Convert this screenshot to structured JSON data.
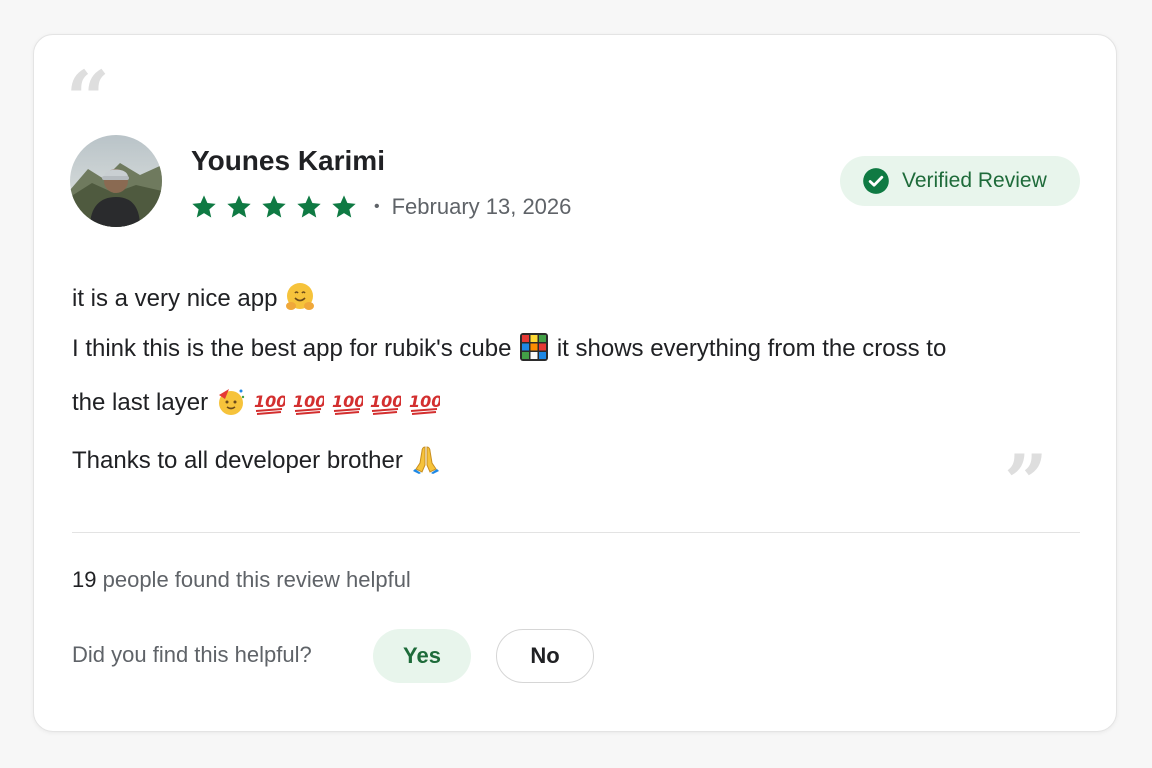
{
  "review": {
    "reviewer_name": "Younes Karimi",
    "rating": 5,
    "rating_max": 5,
    "date": "February 13, 2026",
    "verified_label": "Verified Review",
    "body_lines": {
      "line1": "it is a very nice app",
      "line2a": "I think this is the best app for rubik's cube",
      "line2b": "it shows everything from the cross to",
      "line3": "the last layer",
      "line4": "Thanks to all developer brother"
    },
    "emojis": [
      "hugging-face",
      "rubiks-cube",
      "party-face",
      "hundred-points",
      "hundred-points",
      "hundred-points",
      "hundred-points",
      "hundred-points",
      "folded-hands"
    ]
  },
  "helpful": {
    "count": "19",
    "count_suffix": "people found this review helpful",
    "question": "Did you find this helpful?",
    "yes_label": "Yes",
    "no_label": "No"
  },
  "colors": {
    "star": "#0f7a43",
    "badge_bg": "#e8f5ec",
    "badge_text": "#1e6b3a",
    "quote_marks": "#dedede"
  }
}
